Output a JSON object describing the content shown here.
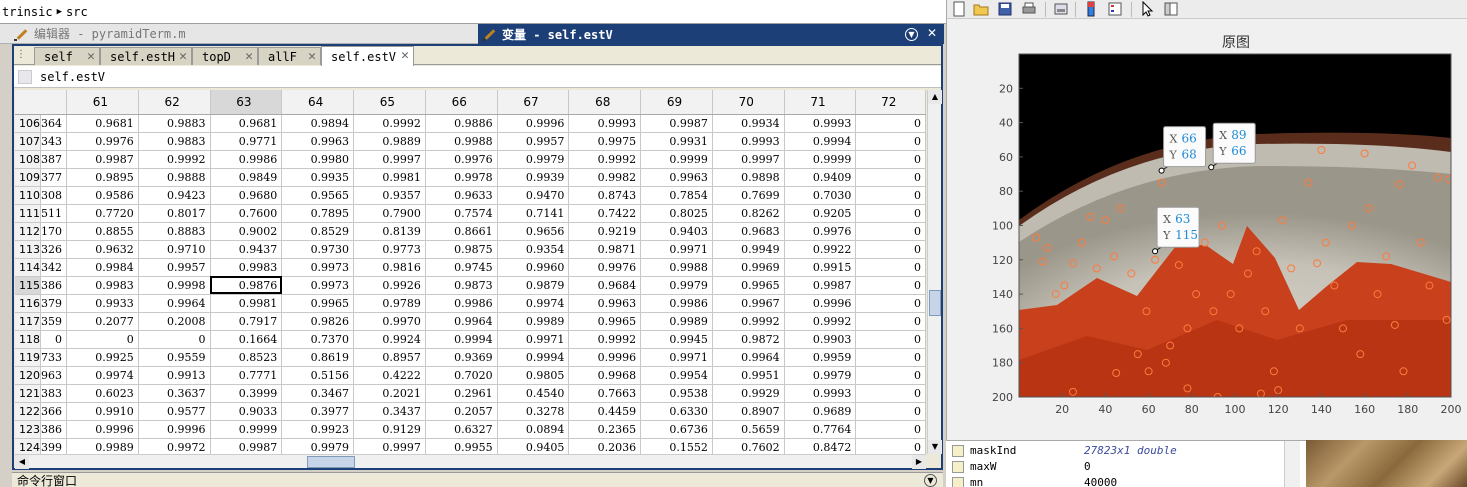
{
  "pathbar": {
    "part1": "trinsic",
    "part2": "src"
  },
  "editor": {
    "title": "编辑器 - pyramidTerm.m"
  },
  "varwindow": {
    "title": "变量 - self.estV"
  },
  "tabs": [
    "self",
    "self.estH",
    "topD",
    "allF",
    "self.estV"
  ],
  "active_tab": "self.estV",
  "varname": "self.estV",
  "grid": {
    "columns": [
      "61",
      "62",
      "63",
      "64",
      "65",
      "66",
      "67",
      "68",
      "69",
      "70",
      "71",
      "72"
    ],
    "selected_column": "63",
    "selected_row": "115",
    "rows": [
      {
        "n": "106",
        "p": "364",
        "v": [
          "0.9681",
          "0.9883",
          "0.9681",
          "0.9894",
          "0.9992",
          "0.9886",
          "0.9996",
          "0.9993",
          "0.9987",
          "0.9934",
          "0.9993",
          "0"
        ]
      },
      {
        "n": "107",
        "p": "343",
        "v": [
          "0.9976",
          "0.9883",
          "0.9771",
          "0.9963",
          "0.9889",
          "0.9988",
          "0.9957",
          "0.9975",
          "0.9931",
          "0.9993",
          "0.9994",
          "0"
        ]
      },
      {
        "n": "108",
        "p": "387",
        "v": [
          "0.9987",
          "0.9992",
          "0.9986",
          "0.9980",
          "0.9997",
          "0.9976",
          "0.9979",
          "0.9992",
          "0.9999",
          "0.9997",
          "0.9999",
          "0"
        ]
      },
      {
        "n": "109",
        "p": "377",
        "v": [
          "0.9895",
          "0.9888",
          "0.9849",
          "0.9935",
          "0.9981",
          "0.9978",
          "0.9939",
          "0.9982",
          "0.9963",
          "0.9898",
          "0.9409",
          "0"
        ]
      },
      {
        "n": "110",
        "p": "308",
        "v": [
          "0.9586",
          "0.9423",
          "0.9680",
          "0.9565",
          "0.9357",
          "0.9633",
          "0.9470",
          "0.8743",
          "0.7854",
          "0.7699",
          "0.7030",
          "0"
        ]
      },
      {
        "n": "111",
        "p": "511",
        "v": [
          "0.7720",
          "0.8017",
          "0.7600",
          "0.7895",
          "0.7900",
          "0.7574",
          "0.7141",
          "0.7422",
          "0.8025",
          "0.8262",
          "0.9205",
          "0"
        ]
      },
      {
        "n": "112",
        "p": "170",
        "v": [
          "0.8855",
          "0.8883",
          "0.9002",
          "0.8529",
          "0.8139",
          "0.8661",
          "0.9656",
          "0.9219",
          "0.9403",
          "0.9683",
          "0.9976",
          "0"
        ]
      },
      {
        "n": "113",
        "p": "326",
        "v": [
          "0.9632",
          "0.9710",
          "0.9437",
          "0.9730",
          "0.9773",
          "0.9875",
          "0.9354",
          "0.9871",
          "0.9971",
          "0.9949",
          "0.9922",
          "0"
        ]
      },
      {
        "n": "114",
        "p": "342",
        "v": [
          "0.9984",
          "0.9957",
          "0.9983",
          "0.9973",
          "0.9816",
          "0.9745",
          "0.9960",
          "0.9976",
          "0.9988",
          "0.9969",
          "0.9915",
          "0"
        ]
      },
      {
        "n": "115",
        "p": "386",
        "v": [
          "0.9983",
          "0.9998",
          "0.9876",
          "0.9973",
          "0.9926",
          "0.9873",
          "0.9879",
          "0.9684",
          "0.9979",
          "0.9965",
          "0.9987",
          "0"
        ]
      },
      {
        "n": "116",
        "p": "379",
        "v": [
          "0.9933",
          "0.9964",
          "0.9981",
          "0.9965",
          "0.9789",
          "0.9986",
          "0.9974",
          "0.9963",
          "0.9986",
          "0.9967",
          "0.9996",
          "0"
        ]
      },
      {
        "n": "117",
        "p": "359",
        "v": [
          "0.2077",
          "0.2008",
          "0.7917",
          "0.9826",
          "0.9970",
          "0.9964",
          "0.9989",
          "0.9965",
          "0.9989",
          "0.9992",
          "0.9992",
          "0"
        ]
      },
      {
        "n": "118",
        "p": "0",
        "v": [
          "0",
          "0",
          "0.1664",
          "0.7370",
          "0.9924",
          "0.9994",
          "0.9971",
          "0.9992",
          "0.9945",
          "0.9872",
          "0.9903",
          "0"
        ]
      },
      {
        "n": "119",
        "p": "733",
        "v": [
          "0.9925",
          "0.9559",
          "0.8523",
          "0.8619",
          "0.8957",
          "0.9369",
          "0.9994",
          "0.9996",
          "0.9971",
          "0.9964",
          "0.9959",
          "0"
        ]
      },
      {
        "n": "120",
        "p": "963",
        "v": [
          "0.9974",
          "0.9913",
          "0.7771",
          "0.5156",
          "0.4222",
          "0.7020",
          "0.9805",
          "0.9968",
          "0.9954",
          "0.9951",
          "0.9979",
          "0"
        ]
      },
      {
        "n": "121",
        "p": "383",
        "v": [
          "0.6023",
          "0.3637",
          "0.3999",
          "0.3467",
          "0.2021",
          "0.2961",
          "0.4540",
          "0.7663",
          "0.9538",
          "0.9929",
          "0.9993",
          "0"
        ]
      },
      {
        "n": "122",
        "p": "366",
        "v": [
          "0.9910",
          "0.9577",
          "0.9033",
          "0.3977",
          "0.3437",
          "0.2057",
          "0.3278",
          "0.4459",
          "0.6330",
          "0.8907",
          "0.9689",
          "0"
        ]
      },
      {
        "n": "123",
        "p": "386",
        "v": [
          "0.9996",
          "0.9996",
          "0.9999",
          "0.9923",
          "0.9129",
          "0.6327",
          "0.0894",
          "0.2365",
          "0.6736",
          "0.5659",
          "0.7764",
          "0"
        ]
      },
      {
        "n": "124",
        "p": "399",
        "v": [
          "0.9989",
          "0.9972",
          "0.9987",
          "0.9979",
          "0.9997",
          "0.9955",
          "0.9405",
          "0.2036",
          "0.1552",
          "0.7602",
          "0.8472",
          "0"
        ]
      }
    ]
  },
  "command_window": {
    "title": "命令行窗口"
  },
  "figure": {
    "title": "原图",
    "xticks": [
      "20",
      "40",
      "60",
      "80",
      "100",
      "120",
      "140",
      "160",
      "180",
      "200"
    ],
    "yticks": [
      "20",
      "40",
      "60",
      "80",
      "100",
      "120",
      "140",
      "160",
      "180",
      "200"
    ],
    "xlim": [
      0,
      200
    ],
    "ylim": [
      0,
      200
    ],
    "datatips": [
      {
        "x": 66,
        "y": 68,
        "xlabel": "X",
        "ylabel": "Y",
        "xval": "66",
        "yval": "68"
      },
      {
        "x": 89,
        "y": 66,
        "xlabel": "X",
        "ylabel": "Y",
        "xval": "89",
        "yval": "66"
      },
      {
        "x": 63,
        "y": 115,
        "xlabel": "X",
        "ylabel": "Y",
        "xval": "63",
        "yval": "115"
      }
    ],
    "markers": [
      [
        8,
        107
      ],
      [
        13,
        113
      ],
      [
        11,
        121
      ],
      [
        17,
        140
      ],
      [
        21,
        135
      ],
      [
        25,
        122
      ],
      [
        29,
        110
      ],
      [
        33,
        95
      ],
      [
        36,
        125
      ],
      [
        40,
        97
      ],
      [
        44,
        118
      ],
      [
        47,
        90
      ],
      [
        52,
        128
      ],
      [
        55,
        175
      ],
      [
        59,
        150
      ],
      [
        63,
        120
      ],
      [
        66,
        75
      ],
      [
        70,
        170
      ],
      [
        74,
        123
      ],
      [
        78,
        160
      ],
      [
        82,
        140
      ],
      [
        86,
        110
      ],
      [
        90,
        150
      ],
      [
        94,
        100
      ],
      [
        98,
        140
      ],
      [
        102,
        160
      ],
      [
        106,
        128
      ],
      [
        110,
        115
      ],
      [
        114,
        150
      ],
      [
        118,
        185
      ],
      [
        122,
        97
      ],
      [
        126,
        125
      ],
      [
        130,
        160
      ],
      [
        134,
        75
      ],
      [
        138,
        122
      ],
      [
        142,
        110
      ],
      [
        146,
        135
      ],
      [
        150,
        160
      ],
      [
        154,
        100
      ],
      [
        158,
        175
      ],
      [
        162,
        90
      ],
      [
        166,
        140
      ],
      [
        170,
        118
      ],
      [
        174,
        158
      ],
      [
        178,
        185
      ],
      [
        182,
        65
      ],
      [
        186,
        110
      ],
      [
        190,
        135
      ],
      [
        194,
        72
      ],
      [
        198,
        155
      ],
      [
        25,
        197
      ],
      [
        45,
        186
      ],
      [
        60,
        185
      ],
      [
        68,
        180
      ],
      [
        78,
        195
      ],
      [
        92,
        200
      ],
      [
        112,
        198
      ],
      [
        120,
        196
      ],
      [
        140,
        56
      ],
      [
        160,
        58
      ],
      [
        176,
        76
      ],
      [
        199,
        73
      ]
    ]
  },
  "workspace": {
    "rows": [
      {
        "name": "maskInd",
        "value": "27823x1 double"
      },
      {
        "name": "maxW",
        "value": "0"
      },
      {
        "name": "mn",
        "value": "40000"
      }
    ]
  },
  "colors": {
    "titlebar": "#1c3f78",
    "datatip_value": "#1f8bd6",
    "marker": "#ff7a3c"
  }
}
